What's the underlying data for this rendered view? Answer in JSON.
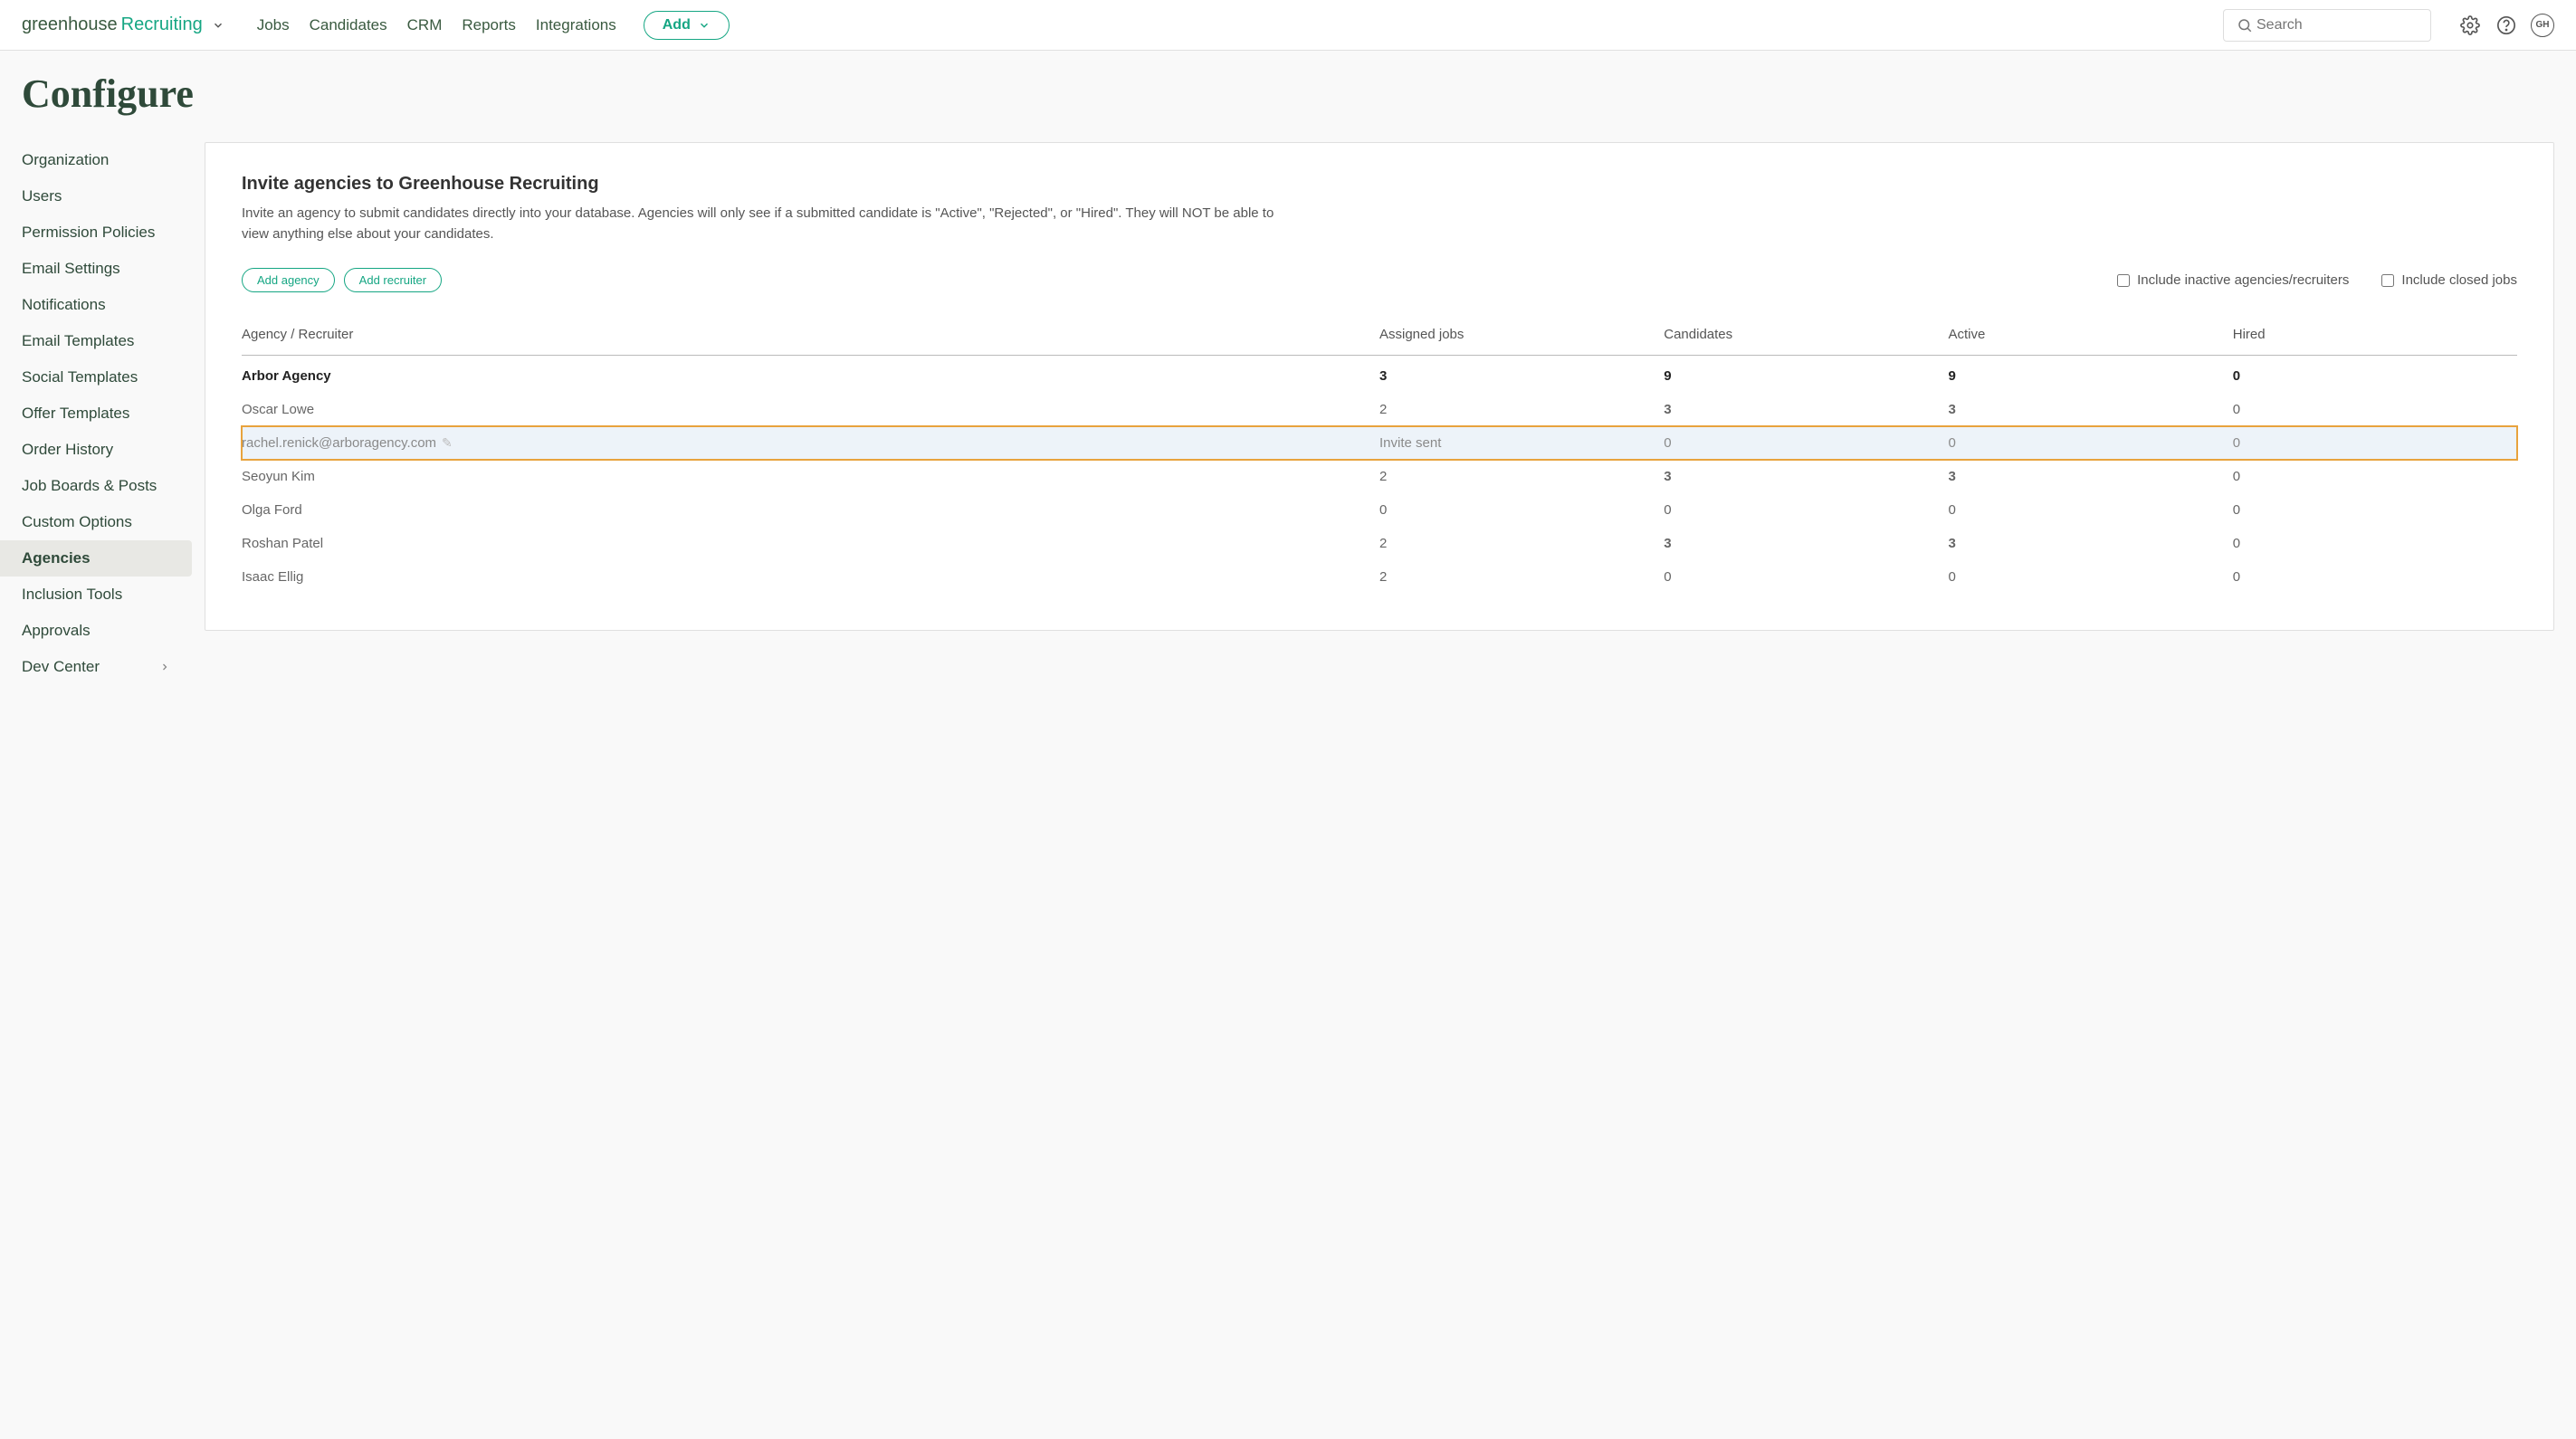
{
  "topbar": {
    "logo_a": "greenhouse",
    "logo_b": "Recruiting",
    "nav": [
      "Jobs",
      "Candidates",
      "CRM",
      "Reports",
      "Integrations"
    ],
    "add_label": "Add",
    "search_placeholder": "Search",
    "avatar_initials": "GH"
  },
  "page": {
    "title": "Configure"
  },
  "sidebar": {
    "items": [
      "Organization",
      "Users",
      "Permission Policies",
      "Email Settings",
      "Notifications",
      "Email Templates",
      "Social Templates",
      "Offer Templates",
      "Order History",
      "Job Boards & Posts",
      "Custom Options",
      "Agencies",
      "Inclusion Tools",
      "Approvals",
      "Dev Center"
    ],
    "active_index": 11,
    "expandable_index": 14
  },
  "main": {
    "heading": "Invite agencies to Greenhouse Recruiting",
    "description": "Invite an agency to submit candidates directly into your database. Agencies will only see if a submitted candidate is \"Active\", \"Rejected\", or \"Hired\". They will NOT be able to view anything else about your candidates.",
    "add_agency_label": "Add agency",
    "add_recruiter_label": "Add recruiter",
    "include_inactive_label": "Include inactive agencies/recruiters",
    "include_closed_label": "Include closed jobs",
    "table": {
      "headers": [
        "Agency / Recruiter",
        "Assigned jobs",
        "Candidates",
        "Active",
        "Hired"
      ],
      "rows": [
        {
          "name": "Arbor Agency",
          "assigned": "3",
          "candidates": "9",
          "active": "9",
          "hired": "0",
          "kind": "agency"
        },
        {
          "name": "Oscar Lowe",
          "assigned": "2",
          "candidates": "3",
          "active": "3",
          "hired": "0",
          "kind": "recruiter"
        },
        {
          "name": "rachel.renick@arboragency.com",
          "assigned": "Invite sent",
          "candidates": "0",
          "active": "0",
          "hired": "0",
          "kind": "invite",
          "highlight": true
        },
        {
          "name": "Seoyun Kim",
          "assigned": "2",
          "candidates": "3",
          "active": "3",
          "hired": "0",
          "kind": "recruiter"
        },
        {
          "name": "Olga Ford",
          "assigned": "0",
          "candidates": "0",
          "active": "0",
          "hired": "0",
          "kind": "recruiter"
        },
        {
          "name": "Roshan Patel",
          "assigned": "2",
          "candidates": "3",
          "active": "3",
          "hired": "0",
          "kind": "recruiter"
        },
        {
          "name": "Isaac Ellig",
          "assigned": "2",
          "candidates": "0",
          "active": "0",
          "hired": "0",
          "kind": "recruiter"
        }
      ]
    }
  }
}
